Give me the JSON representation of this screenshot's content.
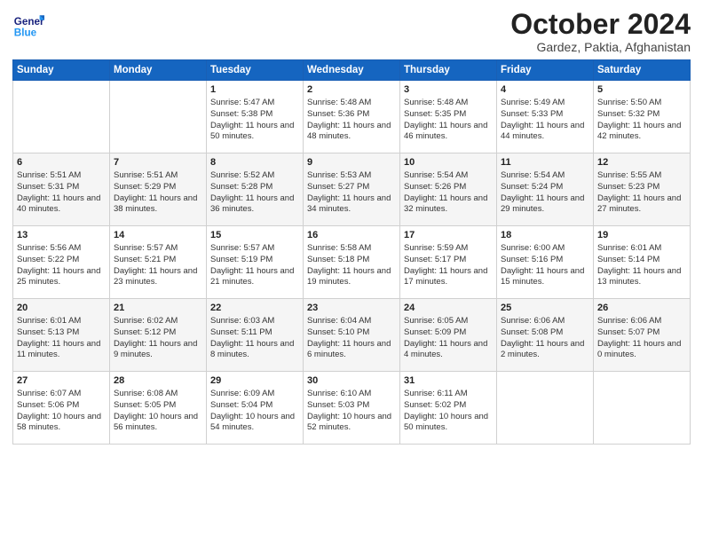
{
  "header": {
    "logo_line1": "General",
    "logo_line2": "Blue",
    "month_title": "October 2024",
    "subtitle": "Gardez, Paktia, Afghanistan"
  },
  "days_of_week": [
    "Sunday",
    "Monday",
    "Tuesday",
    "Wednesday",
    "Thursday",
    "Friday",
    "Saturday"
  ],
  "weeks": [
    [
      {
        "day": "",
        "info": ""
      },
      {
        "day": "",
        "info": ""
      },
      {
        "day": "1",
        "info": "Sunrise: 5:47 AM\nSunset: 5:38 PM\nDaylight: 11 hours and 50 minutes."
      },
      {
        "day": "2",
        "info": "Sunrise: 5:48 AM\nSunset: 5:36 PM\nDaylight: 11 hours and 48 minutes."
      },
      {
        "day": "3",
        "info": "Sunrise: 5:48 AM\nSunset: 5:35 PM\nDaylight: 11 hours and 46 minutes."
      },
      {
        "day": "4",
        "info": "Sunrise: 5:49 AM\nSunset: 5:33 PM\nDaylight: 11 hours and 44 minutes."
      },
      {
        "day": "5",
        "info": "Sunrise: 5:50 AM\nSunset: 5:32 PM\nDaylight: 11 hours and 42 minutes."
      }
    ],
    [
      {
        "day": "6",
        "info": "Sunrise: 5:51 AM\nSunset: 5:31 PM\nDaylight: 11 hours and 40 minutes."
      },
      {
        "day": "7",
        "info": "Sunrise: 5:51 AM\nSunset: 5:29 PM\nDaylight: 11 hours and 38 minutes."
      },
      {
        "day": "8",
        "info": "Sunrise: 5:52 AM\nSunset: 5:28 PM\nDaylight: 11 hours and 36 minutes."
      },
      {
        "day": "9",
        "info": "Sunrise: 5:53 AM\nSunset: 5:27 PM\nDaylight: 11 hours and 34 minutes."
      },
      {
        "day": "10",
        "info": "Sunrise: 5:54 AM\nSunset: 5:26 PM\nDaylight: 11 hours and 32 minutes."
      },
      {
        "day": "11",
        "info": "Sunrise: 5:54 AM\nSunset: 5:24 PM\nDaylight: 11 hours and 29 minutes."
      },
      {
        "day": "12",
        "info": "Sunrise: 5:55 AM\nSunset: 5:23 PM\nDaylight: 11 hours and 27 minutes."
      }
    ],
    [
      {
        "day": "13",
        "info": "Sunrise: 5:56 AM\nSunset: 5:22 PM\nDaylight: 11 hours and 25 minutes."
      },
      {
        "day": "14",
        "info": "Sunrise: 5:57 AM\nSunset: 5:21 PM\nDaylight: 11 hours and 23 minutes."
      },
      {
        "day": "15",
        "info": "Sunrise: 5:57 AM\nSunset: 5:19 PM\nDaylight: 11 hours and 21 minutes."
      },
      {
        "day": "16",
        "info": "Sunrise: 5:58 AM\nSunset: 5:18 PM\nDaylight: 11 hours and 19 minutes."
      },
      {
        "day": "17",
        "info": "Sunrise: 5:59 AM\nSunset: 5:17 PM\nDaylight: 11 hours and 17 minutes."
      },
      {
        "day": "18",
        "info": "Sunrise: 6:00 AM\nSunset: 5:16 PM\nDaylight: 11 hours and 15 minutes."
      },
      {
        "day": "19",
        "info": "Sunrise: 6:01 AM\nSunset: 5:14 PM\nDaylight: 11 hours and 13 minutes."
      }
    ],
    [
      {
        "day": "20",
        "info": "Sunrise: 6:01 AM\nSunset: 5:13 PM\nDaylight: 11 hours and 11 minutes."
      },
      {
        "day": "21",
        "info": "Sunrise: 6:02 AM\nSunset: 5:12 PM\nDaylight: 11 hours and 9 minutes."
      },
      {
        "day": "22",
        "info": "Sunrise: 6:03 AM\nSunset: 5:11 PM\nDaylight: 11 hours and 8 minutes."
      },
      {
        "day": "23",
        "info": "Sunrise: 6:04 AM\nSunset: 5:10 PM\nDaylight: 11 hours and 6 minutes."
      },
      {
        "day": "24",
        "info": "Sunrise: 6:05 AM\nSunset: 5:09 PM\nDaylight: 11 hours and 4 minutes."
      },
      {
        "day": "25",
        "info": "Sunrise: 6:06 AM\nSunset: 5:08 PM\nDaylight: 11 hours and 2 minutes."
      },
      {
        "day": "26",
        "info": "Sunrise: 6:06 AM\nSunset: 5:07 PM\nDaylight: 11 hours and 0 minutes."
      }
    ],
    [
      {
        "day": "27",
        "info": "Sunrise: 6:07 AM\nSunset: 5:06 PM\nDaylight: 10 hours and 58 minutes."
      },
      {
        "day": "28",
        "info": "Sunrise: 6:08 AM\nSunset: 5:05 PM\nDaylight: 10 hours and 56 minutes."
      },
      {
        "day": "29",
        "info": "Sunrise: 6:09 AM\nSunset: 5:04 PM\nDaylight: 10 hours and 54 minutes."
      },
      {
        "day": "30",
        "info": "Sunrise: 6:10 AM\nSunset: 5:03 PM\nDaylight: 10 hours and 52 minutes."
      },
      {
        "day": "31",
        "info": "Sunrise: 6:11 AM\nSunset: 5:02 PM\nDaylight: 10 hours and 50 minutes."
      },
      {
        "day": "",
        "info": ""
      },
      {
        "day": "",
        "info": ""
      }
    ]
  ]
}
